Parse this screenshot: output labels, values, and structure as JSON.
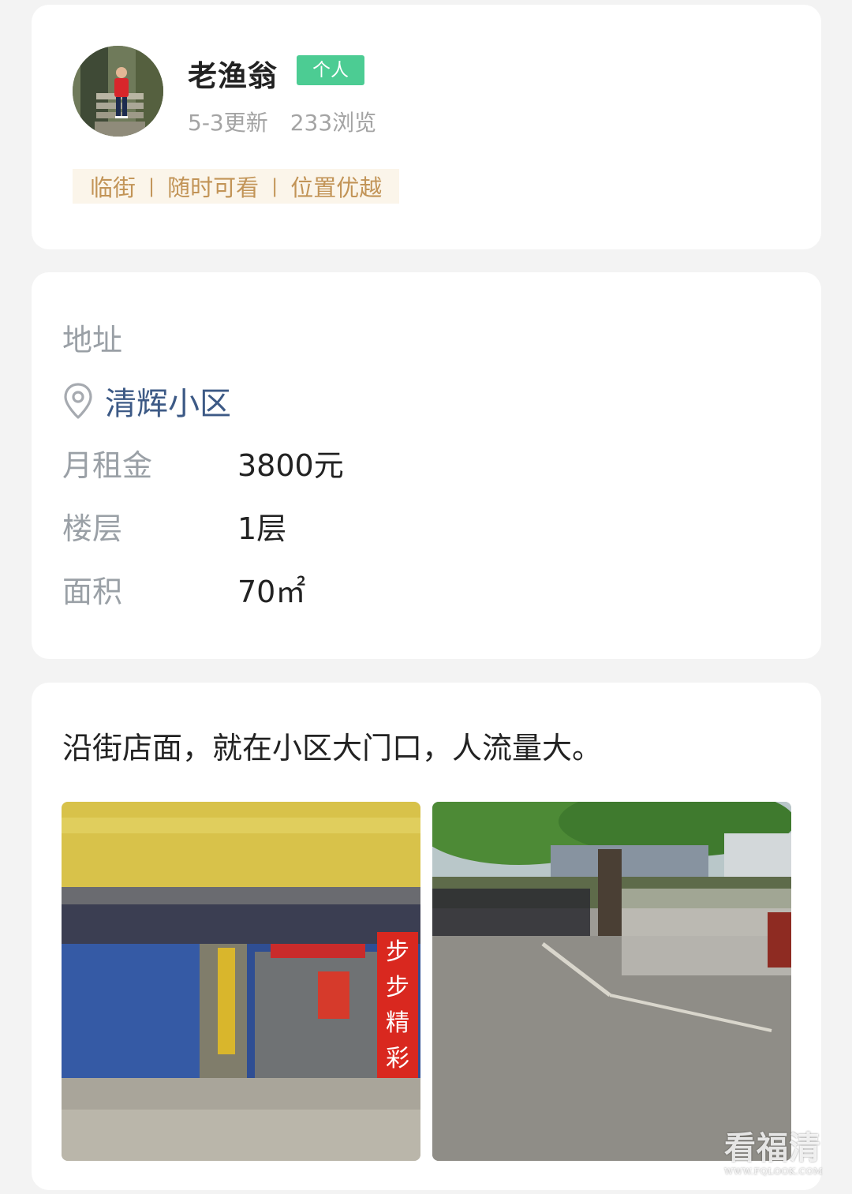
{
  "profile": {
    "name": "老渔翁",
    "badge": "个人",
    "updated": "5-3更新",
    "views": "233浏览",
    "tags": [
      "临街",
      "随时可看",
      "位置优越"
    ],
    "tag_separator": "|"
  },
  "info": {
    "section_title": "地址",
    "address": "清辉小区",
    "address_icon": "location-pin-icon",
    "rows": [
      {
        "label": "月租金",
        "value": "3800元"
      },
      {
        "label": "楼层",
        "value": "1层"
      },
      {
        "label": "面积",
        "value": "70㎡"
      }
    ]
  },
  "description": {
    "text": "沿街店面，就在小区大门口，人流量大。",
    "photos": [
      {
        "signs": [
          "步",
          "步",
          "精",
          "彩"
        ]
      },
      {}
    ]
  },
  "watermark": {
    "logo": "看福清",
    "url": "WWW.FQLOOK.COM"
  },
  "colors": {
    "background": "#f3f3f3",
    "badge": "#4ccc93",
    "tag_text": "#c29457",
    "tag_bg": "#fbf5ea",
    "address_link": "#3d5a86",
    "label_gray": "#9aa0a6"
  }
}
